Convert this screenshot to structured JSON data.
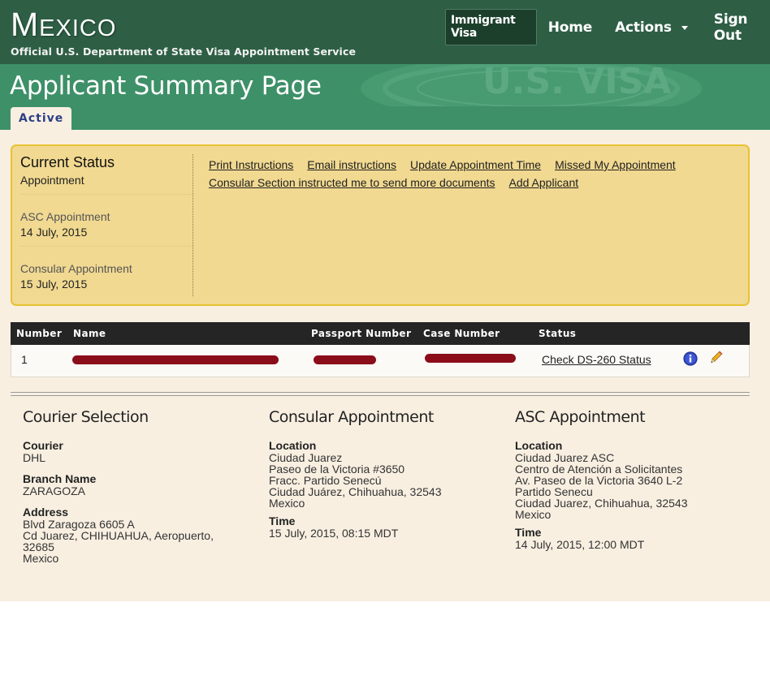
{
  "header": {
    "brand_title": "Mexico",
    "brand_subtitle": "Official U.S. Department of State Visa Appointment Service",
    "nav": {
      "visa_type": "Immigrant Visa",
      "home": "Home",
      "actions": "Actions",
      "sign_out": "Sign Out"
    }
  },
  "banner": {
    "page_title": "Applicant Summary Page",
    "tab_active": "Active",
    "watermark_text": "U.S. VISA"
  },
  "status": {
    "title": "Current Status",
    "value": "Appointment",
    "asc_label": "ASC Appointment",
    "asc_date": "14 July, 2015",
    "consular_label": "Consular Appointment",
    "consular_date": "15 July, 2015",
    "links": [
      "Print Instructions",
      "Email instructions",
      "Update Appointment Time",
      "Missed My Appointment",
      "Consular Section instructed me to send more documents",
      "Add Applicant"
    ]
  },
  "table": {
    "headers": [
      "Number",
      "Name",
      "Passport Number",
      "Case Number",
      "Status"
    ],
    "rows": [
      {
        "number": "1",
        "status_link": "Check DS-260 Status"
      }
    ]
  },
  "courier": {
    "title": "Courier Selection",
    "courier_label": "Courier",
    "courier_value": "DHL",
    "branch_label": "Branch Name",
    "branch_value": "ZARAGOZA",
    "address_label": "Address",
    "address_lines": [
      "Blvd Zaragoza 6605 A",
      "Cd Juarez, CHIHUAHUA, Aeropuerto,",
      "32685",
      "Mexico"
    ]
  },
  "consular": {
    "title": "Consular Appointment",
    "location_label": "Location",
    "location_lines": [
      "Ciudad Juarez",
      "Paseo de la Victoria #3650",
      "Fracc. Partido Senecú",
      "Ciudad Juárez, Chihuahua, 32543",
      "Mexico"
    ],
    "time_label": "Time",
    "time_value": "15 July, 2015, 08:15 MDT"
  },
  "asc": {
    "title": "ASC Appointment",
    "location_label": "Location",
    "location_lines": [
      "Ciudad Juarez ASC",
      "Centro de Atención a Solicitantes",
      "Av. Paseo de la Victoria 3640 L-2",
      "Partido Senecu",
      "Ciudad Juarez, Chihuahua, 32543",
      "Mexico"
    ],
    "time_label": "Time",
    "time_value": "14 July, 2015, 12:00 MDT"
  },
  "icons": {
    "info": "info-icon",
    "edit": "pencil-icon"
  },
  "colors": {
    "header_green": "#2e5f45",
    "banner_green": "#3e9068",
    "status_yellow": "#f1d991",
    "status_border": "#e8c233",
    "content_bg": "#f8efe1",
    "redaction": "#8b0d1a"
  }
}
